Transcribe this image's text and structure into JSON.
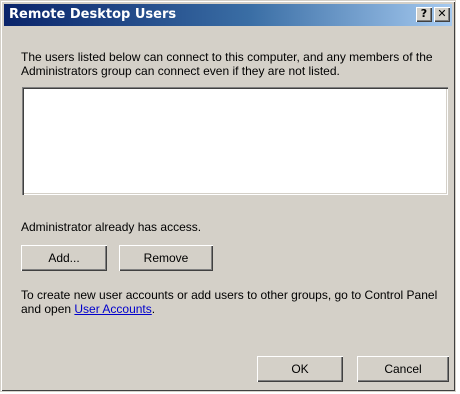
{
  "window": {
    "title": "Remote Desktop Users",
    "help_label": "?",
    "close_label": "✕"
  },
  "description": "The users listed below can connect to this computer, and any members of the Administrators group can connect even if they are not listed.",
  "users_list": [],
  "access_status": "Administrator already has access.",
  "buttons": {
    "add": "Add...",
    "remove": "Remove",
    "ok": "OK",
    "cancel": "Cancel"
  },
  "info": {
    "text_before_link": "To create new user accounts or add users to other groups, go to Control Panel and open ",
    "link_text": "User Accounts",
    "text_after_link": "."
  }
}
